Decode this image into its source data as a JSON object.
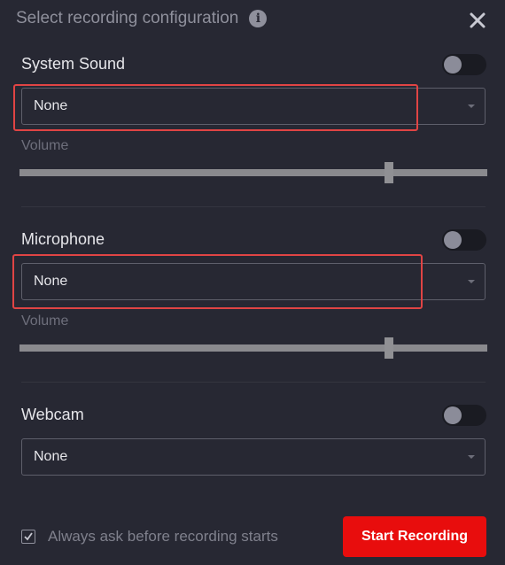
{
  "dialog": {
    "title": "Select recording configuration"
  },
  "system_sound": {
    "label": "System Sound",
    "enabled": false,
    "selected": "None",
    "volume_label": "Volume",
    "volume_level": 0.79
  },
  "microphone": {
    "label": "Microphone",
    "enabled": false,
    "selected": "None",
    "volume_label": "Volume",
    "volume_level": 0.79
  },
  "webcam": {
    "label": "Webcam",
    "enabled": false,
    "selected": "None"
  },
  "footer": {
    "always_ask_label": "Always ask before recording starts",
    "always_ask_checked": true,
    "start_button_label": "Start Recording"
  },
  "colors": {
    "accent": "#e80d0d",
    "highlight_outline": "#e04444",
    "background": "#272833"
  },
  "icons": {
    "info": "info-icon",
    "close": "close-icon",
    "checkbox": "checkmark-icon",
    "caret": "chevron-down-icon"
  }
}
